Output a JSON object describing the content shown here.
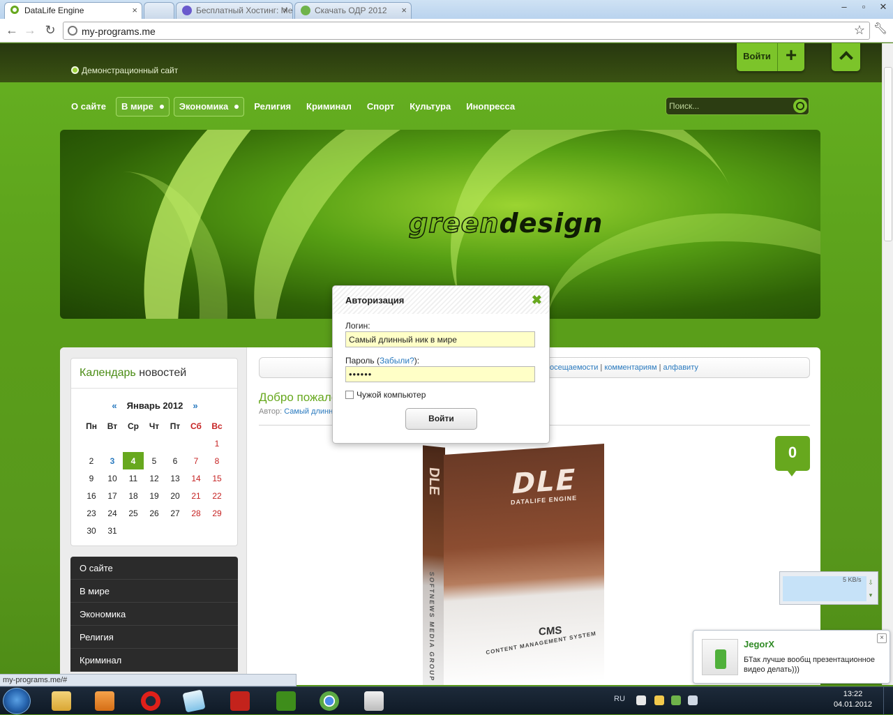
{
  "browser": {
    "tabs": [
      {
        "title": "DataLife Engine",
        "active": true
      },
      {
        "title": "",
        "active": false
      },
      {
        "title": "Бесплатный Хостинг: Меняр...",
        "active": false
      },
      {
        "title": "Скачать ОДР 2012",
        "active": false
      }
    ],
    "url": "my-programs.me",
    "status_url": "my-programs.me/#"
  },
  "site": {
    "tagline": "Демонстрационный сайт",
    "login_label": "Войти",
    "nav": [
      {
        "label": "О сайте",
        "dropdown": false
      },
      {
        "label": "В мире",
        "dropdown": true
      },
      {
        "label": "Экономика",
        "dropdown": true
      },
      {
        "label": "Религия",
        "dropdown": false
      },
      {
        "label": "Криминал",
        "dropdown": false
      },
      {
        "label": "Спорт",
        "dropdown": false
      },
      {
        "label": "Культура",
        "dropdown": false
      },
      {
        "label": "Инопресса",
        "dropdown": false
      }
    ],
    "search_placeholder": "Поиск...",
    "banner_logo_a": "green",
    "banner_logo_b": "design"
  },
  "calendar": {
    "title_a": "Календарь",
    "title_b": "новостей",
    "prev": "«",
    "next": "»",
    "month": "Январь 2012",
    "weekdays": [
      "Пн",
      "Вт",
      "Ср",
      "Чт",
      "Пт",
      "Сб",
      "Вс"
    ],
    "weeks": [
      [
        "",
        "",
        "",
        "",
        "",
        "",
        "1"
      ],
      [
        "2",
        "3",
        "4",
        "5",
        "6",
        "7",
        "8"
      ],
      [
        "9",
        "10",
        "11",
        "12",
        "13",
        "14",
        "15"
      ],
      [
        "16",
        "17",
        "18",
        "19",
        "20",
        "21",
        "22"
      ],
      [
        "23",
        "24",
        "25",
        "26",
        "27",
        "28",
        "29"
      ],
      [
        "30",
        "31",
        "",
        "",
        "",
        "",
        ""
      ]
    ],
    "linked_day": "3",
    "today": "4"
  },
  "sidemenu": [
    "О сайте",
    "В мире",
    "Экономика",
    "Религия",
    "Криминал"
  ],
  "sort": {
    "links": [
      "посещаемости",
      "комментариям",
      "алфавиту"
    ]
  },
  "post": {
    "title": "Добро пожало",
    "author_prefix": "Автор:",
    "author": "Самый длинн",
    "comments": "0",
    "image_title": "DLE",
    "image_sub": "DATALIFE ENGINE",
    "image_cms": "CMS",
    "image_cms2": "CONTENT MANAGEMENT SYSTEM",
    "image_side": "SOFTNEWS MEDIA GROUP"
  },
  "modal": {
    "title": "Авторизация",
    "login_label": "Логин:",
    "login_value": "Самый длинный ник в мире",
    "password_label": "Пароль (",
    "forgot": "Забыли?",
    "password_suffix": "):",
    "password_value": "••••••",
    "remember": "Чужой компьютер",
    "submit": "Войти"
  },
  "download": {
    "speed": "5 KB/s"
  },
  "chat": {
    "name": "JegorX",
    "message": "БТак лучше вообщ презентационное видео делать)))"
  },
  "taskbar": {
    "lang": "RU",
    "time": "13:22",
    "date": "04.01.2012"
  }
}
